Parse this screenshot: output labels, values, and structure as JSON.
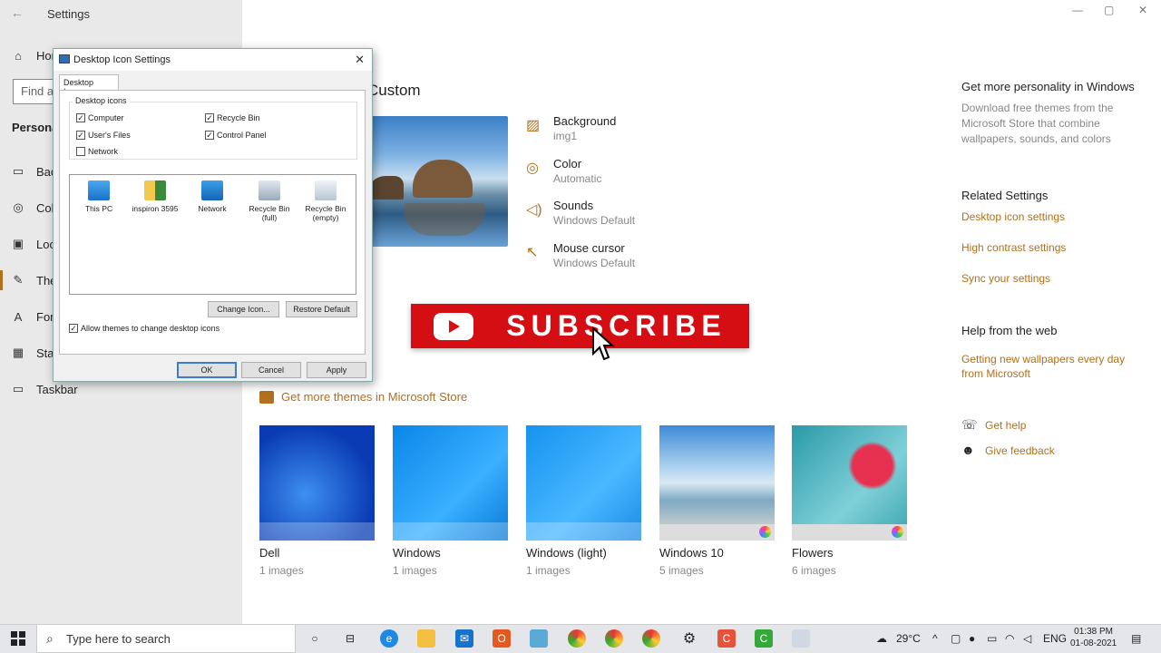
{
  "window": {
    "title": "Settings",
    "back": "←",
    "minimize": "—",
    "maximize": "▢",
    "close": "✕"
  },
  "sidebar": {
    "search_placeholder": "Find a",
    "home": "Hor",
    "section": "Persona",
    "items": [
      {
        "label": "Bac",
        "icon": "image-icon"
      },
      {
        "label": "Col",
        "icon": "palette-icon"
      },
      {
        "label": "Loc",
        "icon": "lock-screen-icon"
      },
      {
        "label": "The",
        "icon": "themes-icon"
      },
      {
        "label": "Fon",
        "icon": "font-icon"
      },
      {
        "label": "Sta",
        "icon": "start-icon"
      },
      {
        "label": "Taskbar",
        "icon": "taskbar-icon"
      }
    ]
  },
  "main": {
    "current_theme_title": "Custom",
    "properties": [
      {
        "title": "Background",
        "value": "img1",
        "icon": "image-icon"
      },
      {
        "title": "Color",
        "value": "Automatic",
        "icon": "palette-icon"
      },
      {
        "title": "Sounds",
        "value": "Windows Default",
        "icon": "speaker-icon"
      },
      {
        "title": "Mouse cursor",
        "value": "Windows Default",
        "icon": "cursor-icon"
      }
    ],
    "subscribe_label": "SUBSCRIBE",
    "store_link": "Get more themes in Microsoft Store",
    "themes": [
      {
        "name": "Dell",
        "count": "1 images"
      },
      {
        "name": "Windows",
        "count": "1 images"
      },
      {
        "name": "Windows (light)",
        "count": "1 images"
      },
      {
        "name": "Windows 10",
        "count": "5 images"
      },
      {
        "name": "Flowers",
        "count": "6 images"
      }
    ]
  },
  "right_panel": {
    "personality_heading": "Get more personality in Windows",
    "personality_text": "Download free themes from the Microsoft Store that combine wallpapers, sounds, and colors",
    "related_heading": "Related Settings",
    "related_links": [
      "Desktop icon settings",
      "High contrast settings",
      "Sync your settings"
    ],
    "help_heading": "Help from the web",
    "help_link": "Getting new wallpapers every day from Microsoft",
    "get_help": "Get help",
    "give_feedback": "Give feedback"
  },
  "dialog": {
    "title": "Desktop Icon Settings",
    "close": "✕",
    "tab": "Desktop Icons",
    "group_label": "Desktop icons",
    "checkboxes": [
      {
        "label": "Computer",
        "checked": "✓"
      },
      {
        "label": "Recycle Bin",
        "checked": "✓"
      },
      {
        "label": "User's Files",
        "checked": "✓"
      },
      {
        "label": "Control Panel",
        "checked": "✓"
      },
      {
        "label": "Network",
        "checked": ""
      }
    ],
    "icons": [
      {
        "label": "This PC"
      },
      {
        "label": "inspiron 3595"
      },
      {
        "label": "Network"
      },
      {
        "label": "Recycle Bin (full)"
      },
      {
        "label": "Recycle Bin (empty)"
      }
    ],
    "change_icon": "Change Icon...",
    "restore_default": "Restore Default",
    "allow_themes": "Allow themes to change desktop icons",
    "allow_themes_checked": "✓",
    "ok": "OK",
    "cancel": "Cancel",
    "apply": "Apply"
  },
  "taskbar": {
    "search_placeholder": "Type here to search",
    "weather": "29°C",
    "language": "ENG",
    "time": "01:38 PM",
    "date": "01-08-2021"
  }
}
